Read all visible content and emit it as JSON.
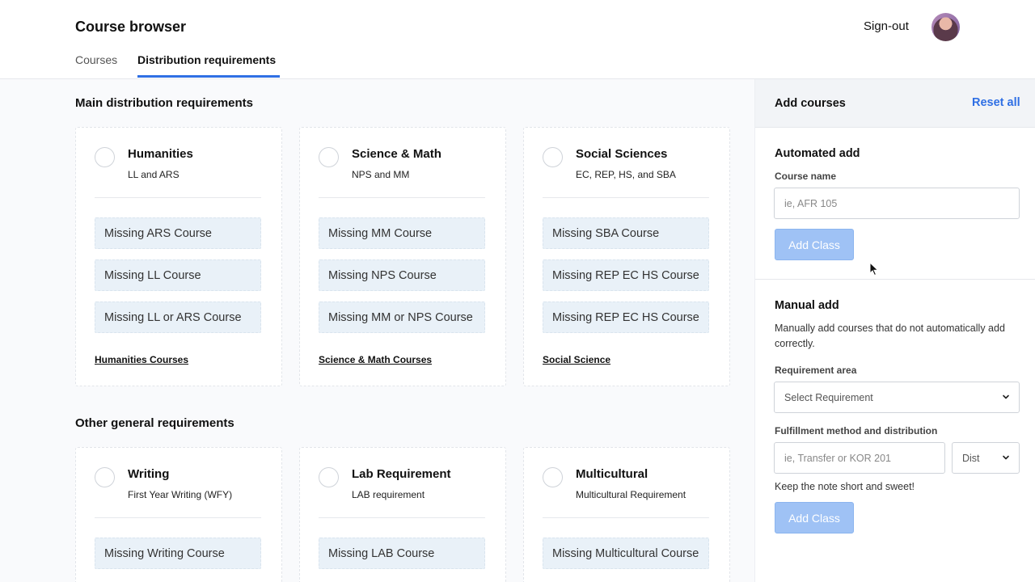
{
  "app": {
    "title": "Course browser",
    "sign_out": "Sign-out"
  },
  "tabs": [
    {
      "label": "Courses",
      "active": false
    },
    {
      "label": "Distribution requirements",
      "active": true
    }
  ],
  "main": {
    "main_heading": "Main distribution requirements",
    "other_heading": "Other general requirements",
    "main_cards": [
      {
        "title": "Humanities",
        "subtitle": "LL and ARS",
        "missing": [
          "Missing ARS Course",
          "Missing LL Course",
          "Missing LL or ARS Course"
        ],
        "link": "Humanities Courses"
      },
      {
        "title": "Science & Math",
        "subtitle": "NPS and MM",
        "missing": [
          "Missing MM Course",
          "Missing NPS Course",
          "Missing MM or NPS Course"
        ],
        "link": "Science & Math Courses"
      },
      {
        "title": "Social Sciences",
        "subtitle": "EC, REP, HS, and SBA",
        "missing": [
          "Missing SBA Course",
          "Missing REP EC HS Course",
          "Missing REP EC HS Course"
        ],
        "link": "Social Science"
      }
    ],
    "other_cards": [
      {
        "title": "Writing",
        "subtitle": "First Year Writing (WFY)",
        "missing": [
          "Missing Writing Course"
        ]
      },
      {
        "title": "Lab Requirement",
        "subtitle": "LAB requirement",
        "missing": [
          "Missing LAB Course"
        ]
      },
      {
        "title": "Multicultural",
        "subtitle": "Multicultural Requirement",
        "missing": [
          "Missing Multicultural Course"
        ]
      }
    ]
  },
  "panel": {
    "title": "Add courses",
    "reset_all": "Reset all",
    "automated": {
      "heading": "Automated add",
      "course_label": "Course name",
      "course_placeholder": "ie, AFR 105",
      "button": "Add Class"
    },
    "manual": {
      "heading": "Manual add",
      "description": "Manually add courses that do not automatically add correctly.",
      "requirement_label": "Requirement area",
      "requirement_value": "Select Requirement",
      "fulfillment_label": "Fulfillment method and distribution",
      "fulfillment_placeholder": "ie, Transfer or KOR 201",
      "dist_value": "Dist",
      "note": "Keep the note short and sweet!",
      "button": "Add Class"
    }
  },
  "colors": {
    "accent": "#2f6fe4",
    "button_disabled": "#9fc2f5",
    "missing_bg": "#e9f1f8"
  }
}
